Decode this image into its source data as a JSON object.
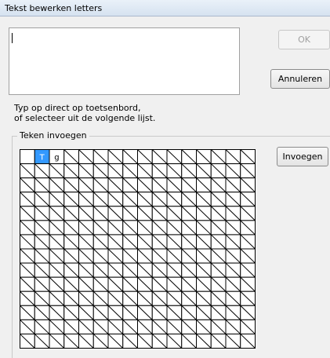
{
  "window": {
    "title": "Tekst bewerken letters"
  },
  "text_input": {
    "value": ""
  },
  "buttons": {
    "ok": "OK",
    "cancel": "Annuleren",
    "insert": "Invoegen"
  },
  "hint": {
    "line1": "Typ op direct op toetsenbord,",
    "line2": "of selecteer uit de volgende lijst."
  },
  "group": {
    "label": "Teken invoegen"
  },
  "char_grid": {
    "rows": 14,
    "cols": 16,
    "cells": [
      {
        "row": 0,
        "col": 1,
        "char": "T",
        "selected": true
      },
      {
        "row": 0,
        "col": 2,
        "char": "g",
        "selected": false
      }
    ],
    "empty_cell": {
      "row": 0,
      "col": 0
    },
    "selected_color": "#3399ff"
  }
}
